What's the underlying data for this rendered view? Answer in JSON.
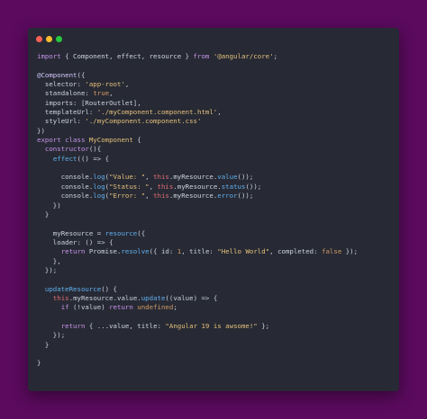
{
  "window": {
    "controls": [
      {
        "name": "close",
        "color": "#ff5f56"
      },
      {
        "name": "minimize",
        "color": "#ffbd2e"
      },
      {
        "name": "zoom",
        "color": "#27c93f"
      }
    ]
  },
  "code": {
    "lines": [
      [
        {
          "t": "import",
          "c": "kw"
        },
        {
          "t": " { Component, effect, resource } ",
          "c": "op"
        },
        {
          "t": "from",
          "c": "kw"
        },
        {
          "t": " ",
          "c": "op"
        },
        {
          "t": "'@angular/core'",
          "c": "str"
        },
        {
          "t": ";",
          "c": "op"
        }
      ],
      [],
      [
        {
          "t": "@Component",
          "c": "dec"
        },
        {
          "t": "({",
          "c": "op"
        }
      ],
      [
        {
          "t": "  selector",
          "c": "prop"
        },
        {
          "t": ": ",
          "c": "op"
        },
        {
          "t": "'app-root'",
          "c": "str"
        },
        {
          "t": ",",
          "c": "op"
        }
      ],
      [
        {
          "t": "  standalone",
          "c": "prop"
        },
        {
          "t": ": ",
          "c": "op"
        },
        {
          "t": "true",
          "c": "num"
        },
        {
          "t": ",",
          "c": "op"
        }
      ],
      [
        {
          "t": "  imports",
          "c": "prop"
        },
        {
          "t": ": [RouterOutlet],",
          "c": "op"
        }
      ],
      [
        {
          "t": "  templateUrl",
          "c": "prop"
        },
        {
          "t": ": ",
          "c": "op"
        },
        {
          "t": "'./myComponent.component.html'",
          "c": "str"
        },
        {
          "t": ",",
          "c": "op"
        }
      ],
      [
        {
          "t": "  styleUrl",
          "c": "prop"
        },
        {
          "t": ": ",
          "c": "op"
        },
        {
          "t": "'./myComponent.component.css'",
          "c": "str"
        }
      ],
      [
        {
          "t": "})",
          "c": "op"
        }
      ],
      [
        {
          "t": "export",
          "c": "kw"
        },
        {
          "t": " ",
          "c": "op"
        },
        {
          "t": "class",
          "c": "kw"
        },
        {
          "t": " ",
          "c": "op"
        },
        {
          "t": "MyComponent",
          "c": "str"
        },
        {
          "t": " {",
          "c": "op"
        }
      ],
      [
        {
          "t": "  ",
          "c": "op"
        },
        {
          "t": "constructor",
          "c": "kw"
        },
        {
          "t": "(){",
          "c": "op"
        }
      ],
      [
        {
          "t": "    ",
          "c": "op"
        },
        {
          "t": "effect",
          "c": "fn"
        },
        {
          "t": "(() => {",
          "c": "op"
        }
      ],
      [],
      [
        {
          "t": "      console.",
          "c": "op"
        },
        {
          "t": "log",
          "c": "fn"
        },
        {
          "t": "(",
          "c": "op"
        },
        {
          "t": "\"Value: \"",
          "c": "str"
        },
        {
          "t": ", ",
          "c": "op"
        },
        {
          "t": "this",
          "c": "var"
        },
        {
          "t": ".myResource.",
          "c": "op"
        },
        {
          "t": "value",
          "c": "fn"
        },
        {
          "t": "());",
          "c": "op"
        }
      ],
      [
        {
          "t": "      console.",
          "c": "op"
        },
        {
          "t": "log",
          "c": "fn"
        },
        {
          "t": "(",
          "c": "op"
        },
        {
          "t": "\"Status: \"",
          "c": "str"
        },
        {
          "t": ", ",
          "c": "op"
        },
        {
          "t": "this",
          "c": "var"
        },
        {
          "t": ".myResource.",
          "c": "op"
        },
        {
          "t": "status",
          "c": "fn"
        },
        {
          "t": "());",
          "c": "op"
        }
      ],
      [
        {
          "t": "      console.",
          "c": "op"
        },
        {
          "t": "log",
          "c": "fn"
        },
        {
          "t": "(",
          "c": "op"
        },
        {
          "t": "\"Error: \"",
          "c": "str"
        },
        {
          "t": ", ",
          "c": "op"
        },
        {
          "t": "this",
          "c": "var"
        },
        {
          "t": ".myResource.",
          "c": "op"
        },
        {
          "t": "error",
          "c": "fn"
        },
        {
          "t": "());",
          "c": "op"
        }
      ],
      [
        {
          "t": "    })",
          "c": "op"
        }
      ],
      [
        {
          "t": "  }",
          "c": "op"
        }
      ],
      [],
      [
        {
          "t": "    myResource = ",
          "c": "op"
        },
        {
          "t": "resource",
          "c": "fn"
        },
        {
          "t": "({",
          "c": "op"
        }
      ],
      [
        {
          "t": "    loader",
          "c": "prop"
        },
        {
          "t": ": () => {",
          "c": "op"
        }
      ],
      [
        {
          "t": "      ",
          "c": "op"
        },
        {
          "t": "return",
          "c": "kw"
        },
        {
          "t": " Promise.",
          "c": "op"
        },
        {
          "t": "resolve",
          "c": "fn"
        },
        {
          "t": "({ ",
          "c": "op"
        },
        {
          "t": "id",
          "c": "prop"
        },
        {
          "t": ": ",
          "c": "op"
        },
        {
          "t": "1",
          "c": "num"
        },
        {
          "t": ", ",
          "c": "op"
        },
        {
          "t": "title",
          "c": "prop"
        },
        {
          "t": ": ",
          "c": "op"
        },
        {
          "t": "\"Hello World\"",
          "c": "str"
        },
        {
          "t": ", ",
          "c": "op"
        },
        {
          "t": "completed",
          "c": "prop"
        },
        {
          "t": ": ",
          "c": "op"
        },
        {
          "t": "false",
          "c": "num"
        },
        {
          "t": " });",
          "c": "op"
        }
      ],
      [
        {
          "t": "    },",
          "c": "op"
        }
      ],
      [
        {
          "t": "  });",
          "c": "op"
        }
      ],
      [],
      [
        {
          "t": "  ",
          "c": "op"
        },
        {
          "t": "updateResource",
          "c": "fn"
        },
        {
          "t": "() {",
          "c": "op"
        }
      ],
      [
        {
          "t": "    ",
          "c": "op"
        },
        {
          "t": "this",
          "c": "var"
        },
        {
          "t": ".myResource.value.",
          "c": "op"
        },
        {
          "t": "update",
          "c": "fn"
        },
        {
          "t": "((value) => {",
          "c": "op"
        }
      ],
      [
        {
          "t": "      ",
          "c": "op"
        },
        {
          "t": "if",
          "c": "kw"
        },
        {
          "t": " (!value) ",
          "c": "op"
        },
        {
          "t": "return",
          "c": "kw"
        },
        {
          "t": " ",
          "c": "op"
        },
        {
          "t": "undefined",
          "c": "num"
        },
        {
          "t": ";",
          "c": "op"
        }
      ],
      [],
      [
        {
          "t": "      ",
          "c": "op"
        },
        {
          "t": "return",
          "c": "kw"
        },
        {
          "t": " { ...value, ",
          "c": "op"
        },
        {
          "t": "title",
          "c": "prop"
        },
        {
          "t": ": ",
          "c": "op"
        },
        {
          "t": "\"Angular 19 is awsome!\"",
          "c": "str"
        },
        {
          "t": " };",
          "c": "op"
        }
      ],
      [
        {
          "t": "    });",
          "c": "op"
        }
      ],
      [
        {
          "t": "  }",
          "c": "op"
        }
      ],
      [],
      [
        {
          "t": "}",
          "c": "op"
        }
      ]
    ]
  }
}
